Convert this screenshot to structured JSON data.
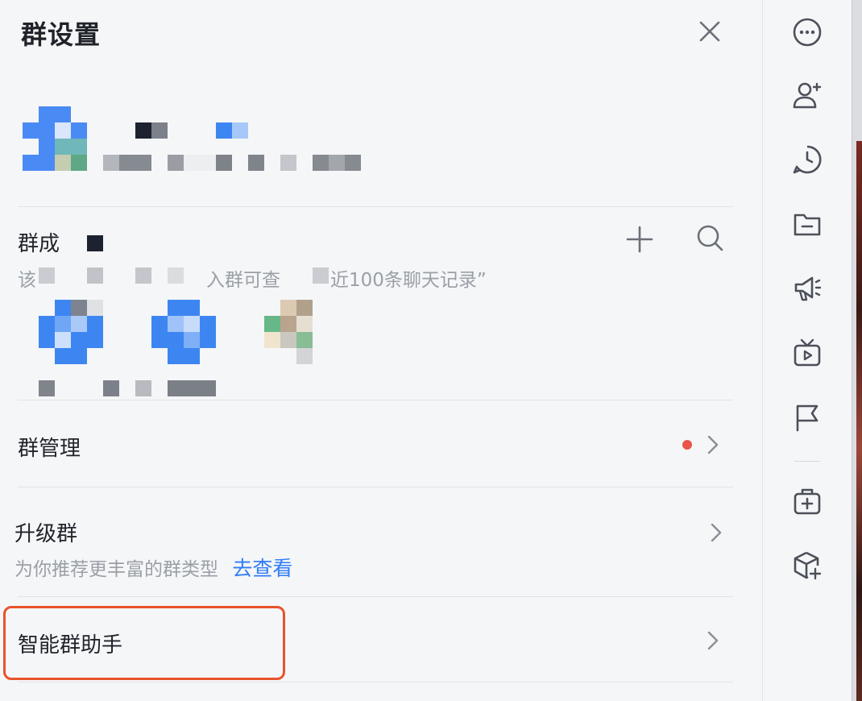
{
  "header": {
    "title": "群设置"
  },
  "members": {
    "label": "群成",
    "hint_prefix": "该",
    "hint_mid": "入群可查",
    "hint_suffix": "近100条聊天记录”"
  },
  "group_manage": {
    "label": "群管理"
  },
  "upgrade": {
    "label": "升级群",
    "hint": "为你推荐更丰富的群类型",
    "link": "去查看"
  },
  "assistant": {
    "label": "智能群助手"
  },
  "colors": {
    "accent": "#2f7cf6",
    "highlight": "#e8532a",
    "badge": "#e8554a"
  },
  "rail_icons": [
    "more-icon",
    "add-user-icon",
    "history-icon",
    "folder-icon",
    "announcement-icon",
    "video-icon",
    "flag-icon",
    "toolbox-icon",
    "add-app-icon"
  ]
}
